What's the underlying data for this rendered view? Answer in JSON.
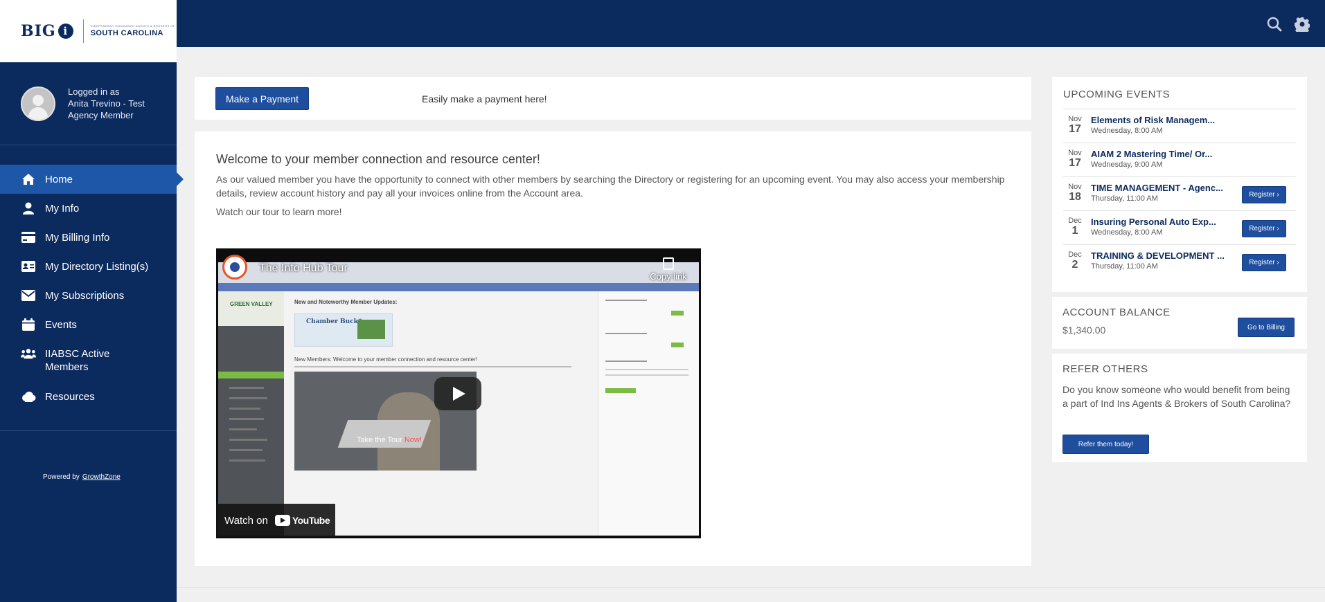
{
  "brand": {
    "logo_big": "BIG",
    "logo_i": "i",
    "logo_small": "INDEPENDENT INSURANCE AGENTS & BROKERS OF",
    "logo_state": "SOUTH CAROLINA"
  },
  "user": {
    "logged_in_line1": "Logged in as",
    "logged_in_name": "Anita Trevino - Test Agency Member"
  },
  "sidebar": {
    "items": [
      {
        "label": "Home",
        "icon": "home-icon"
      },
      {
        "label": "My Info",
        "icon": "user-icon"
      },
      {
        "label": "My Billing Info",
        "icon": "credit-card-icon"
      },
      {
        "label": "My Directory Listing(s)",
        "icon": "id-card-icon"
      },
      {
        "label": "My Subscriptions",
        "icon": "envelope-icon"
      },
      {
        "label": "Events",
        "icon": "calendar-icon"
      },
      {
        "label": "IIABSC Active Members",
        "icon": "users-icon"
      },
      {
        "label": "Resources",
        "icon": "cloud-icon"
      }
    ],
    "powered_by": "Powered by",
    "powered_link": "GrowthZone"
  },
  "topbar": {
    "search_icon": "search-icon",
    "settings_icon": "gear-icon"
  },
  "payment": {
    "button_label": "Make a Payment",
    "text": "Easily make a payment here!"
  },
  "welcome": {
    "title": "Welcome to your member connection and resource center!",
    "body": "As our valued member you have the opportunity to connect with other members by searching the Directory or registering for an upcoming event. You may also access your membership details, review account history and pay all your invoices online from the Account area.",
    "tour": "Watch our tour to learn more!"
  },
  "video": {
    "title": "The Info Hub Tour",
    "copy_link": "Copy link",
    "watch_on": "Watch on",
    "youtube": "YouTube",
    "inner_new_noteworthy": "New and Noteworthy Member Updates:",
    "inner_new_members": "New Members: Welcome to your member connection and resource center!",
    "inner_green_valley": "GREEN VALLEY",
    "inner_chamber": "Chamber Buck$",
    "inner_take_tour": "Take the Tour",
    "inner_now": "Now!"
  },
  "events": {
    "title": "UPCOMING EVENTS",
    "items": [
      {
        "month": "Nov",
        "day": "17",
        "title": "Elements of Risk Managem...",
        "when": "Wednesday, 8:00 AM",
        "register": ""
      },
      {
        "month": "Nov",
        "day": "17",
        "title": "AIAM 2 Mastering Time/ Or...",
        "when": "Wednesday, 9:00 AM",
        "register": ""
      },
      {
        "month": "Nov",
        "day": "18",
        "title": "TIME MANAGEMENT - Agenc...",
        "when": "Thursday, 11:00 AM",
        "register": "Register ›"
      },
      {
        "month": "Dec",
        "day": "1",
        "title": "Insuring Personal Auto Exp...",
        "when": "Wednesday, 8:00 AM",
        "register": "Register ›"
      },
      {
        "month": "Dec",
        "day": "2",
        "title": "TRAINING & DEVELOPMENT ...",
        "when": "Thursday, 11:00 AM",
        "register": "Register ›"
      }
    ]
  },
  "balance": {
    "title": "ACCOUNT BALANCE",
    "amount": "$1,340.00",
    "button": "Go to Billing"
  },
  "refer": {
    "title": "REFER OTHERS",
    "text": "Do you know someone who would benefit from being a part of Ind Ins Agents & Brokers of South Carolina?",
    "button": "Refer them today!"
  },
  "colors": {
    "navy": "#0b2a5e",
    "active_nav": "#1e56a8",
    "button_blue": "#1e4e9d",
    "page_bg": "#f0f0f0"
  }
}
